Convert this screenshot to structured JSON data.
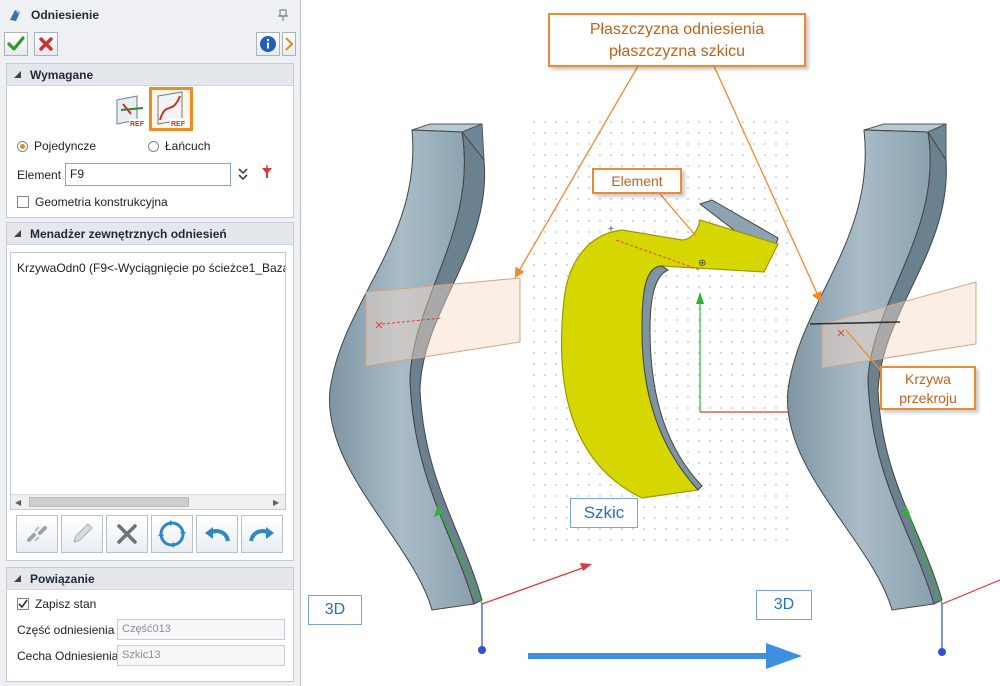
{
  "dialog": {
    "title": "Odniesienie",
    "sections": {
      "required": {
        "header": "Wymagane",
        "ref_buttons": [
          "REF",
          "REF"
        ],
        "radio_single": "Pojedyncze",
        "radio_chain": "Łańcuch",
        "selected_radio": "Pojedyncze",
        "element_label": "Element",
        "element_value": "F9",
        "construction_geometry_label": "Geometria konstrukcyjna",
        "construction_geometry_checked": false
      },
      "external_refs": {
        "header": "Menadżer zewnętrznych odniesień",
        "items": [
          "KrzywaOdn0  (F9<-Wyciągnięcie po ścieżce1_Baza"
        ]
      },
      "binding": {
        "header": "Powiązanie",
        "save_state_label": "Zapisz stan",
        "save_state_checked": true,
        "ref_part_label": "Część odniesienia",
        "ref_part_value": "Część013",
        "ref_feature_label": "Cecha Odniesienia",
        "ref_feature_value": "Szkic13"
      }
    }
  },
  "viewport": {
    "callouts": {
      "plane": [
        "Płaszczyzna odniesienia",
        "płaszczyzna szkicu"
      ],
      "element": "Element",
      "sketch": "Szkic",
      "section_curve": [
        "Krzywa",
        "przekroju"
      ],
      "left_3d": "3D",
      "right_3d": "3D"
    },
    "colors": {
      "callout_border": "#ef8a31",
      "callout_text": "#c0621a",
      "part_body": "#8ea3b1",
      "highlight": "#d6d600",
      "arrow": "#3f8fe0"
    }
  }
}
